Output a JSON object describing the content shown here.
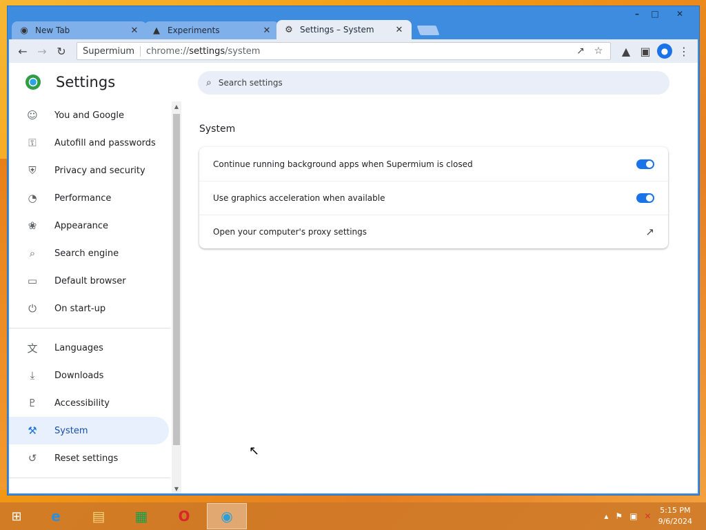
{
  "window": {
    "controls": [
      "–",
      "□",
      "✕"
    ]
  },
  "tabs": [
    {
      "title": "New Tab",
      "icon": "chrome-icon",
      "glyph": "◉",
      "close": "✕"
    },
    {
      "title": "Experiments",
      "icon": "flask-icon",
      "glyph": "▲",
      "close": "✕"
    },
    {
      "title": "Settings – System",
      "icon": "gear-icon",
      "glyph": "⚙",
      "close": "✕"
    }
  ],
  "toolbar": {
    "back": "←",
    "forward": "→",
    "reload": "↻",
    "omnibox_site": "Supermium",
    "url_prefix": "chrome://",
    "url_path": "settings",
    "url_suffix": "/system",
    "share": "↗",
    "bookmark": "☆",
    "labs": "▲",
    "sidepanel": "▣",
    "menu": "⋮",
    "avatar": "●"
  },
  "settings": {
    "title": "Settings",
    "search_placeholder": "Search settings",
    "search_icon": "⌕"
  },
  "sidebar": {
    "items": [
      {
        "label": "You and Google",
        "icon": "☺"
      },
      {
        "label": "Autofill and passwords",
        "icon": "⚿"
      },
      {
        "label": "Privacy and security",
        "icon": "⛨"
      },
      {
        "label": "Performance",
        "icon": "◔"
      },
      {
        "label": "Appearance",
        "icon": "❀"
      },
      {
        "label": "Search engine",
        "icon": "⌕"
      },
      {
        "label": "Default browser",
        "icon": "▭"
      },
      {
        "label": "On start-up",
        "icon": "⏻"
      }
    ],
    "items2": [
      {
        "label": "Languages",
        "icon": "文"
      },
      {
        "label": "Downloads",
        "icon": "⤓"
      },
      {
        "label": "Accessibility",
        "icon": "♇"
      },
      {
        "label": "System",
        "icon": "⚒"
      },
      {
        "label": "Reset settings",
        "icon": "↺"
      }
    ],
    "active": "System"
  },
  "main": {
    "section_title": "System",
    "rows": [
      {
        "label": "Continue running background apps when Supermium is closed",
        "control": "toggle",
        "on": true
      },
      {
        "label": "Use graphics acceleration when available",
        "control": "toggle",
        "on": true
      },
      {
        "label": "Open your computer's proxy settings",
        "control": "external-link",
        "glyph": "↗"
      }
    ]
  },
  "taskbar": {
    "start": "⊞",
    "apps": [
      {
        "name": "internet-explorer-icon",
        "glyph": "e",
        "color": "#2a8fe0"
      },
      {
        "name": "file-explorer-icon",
        "glyph": "▤",
        "color": "#f2d27a"
      },
      {
        "name": "store-icon",
        "glyph": "▦",
        "color": "#1aa04a"
      },
      {
        "name": "opera-icon",
        "glyph": "O",
        "color": "#d8262b"
      },
      {
        "name": "supermium-icon",
        "glyph": "◉",
        "color": "#2a9fd8"
      }
    ],
    "tray_arrow": "▴",
    "tray_flag": "⚑",
    "tray_network": "▣",
    "tray_volume": "✕",
    "time": "5:15 PM",
    "date": "9/6/2024"
  },
  "cursor": "↖"
}
